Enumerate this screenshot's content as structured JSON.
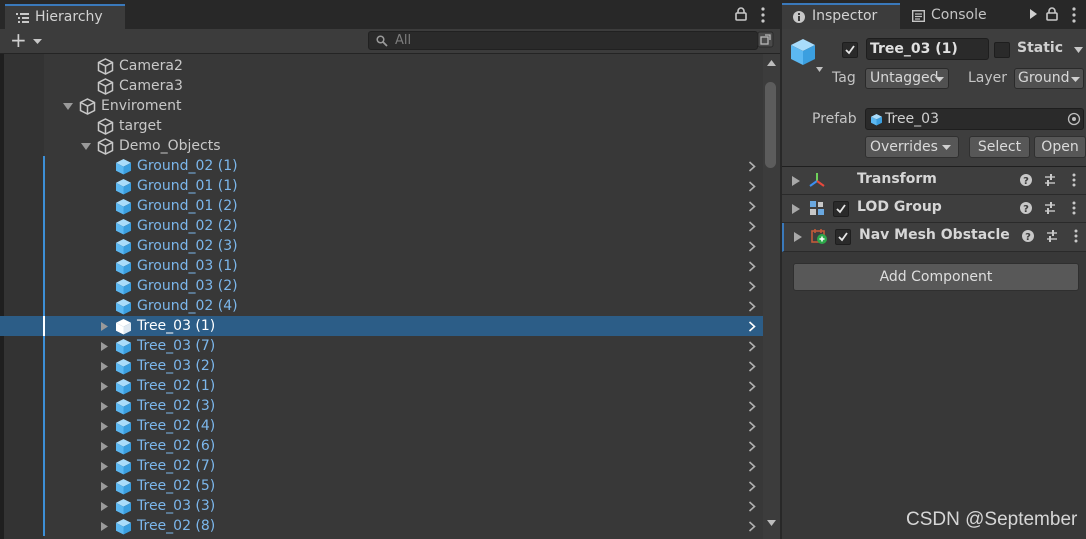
{
  "hierarchy": {
    "tab_label": "Hierarchy",
    "search_placeholder": "All",
    "add_button_label": "+",
    "rows": [
      {
        "name": "Camera2",
        "kind": "plain",
        "indent": 1,
        "expandable": false
      },
      {
        "name": "Camera3",
        "kind": "plain",
        "indent": 1,
        "expandable": false
      },
      {
        "name": "Enviroment",
        "kind": "plain",
        "indent": 0,
        "expandable": true,
        "expanded": true
      },
      {
        "name": "target",
        "kind": "plain",
        "indent": 1,
        "expandable": false
      },
      {
        "name": "Demo_Objects",
        "kind": "plain",
        "indent": 1,
        "expandable": true,
        "expanded": true
      },
      {
        "name": "Ground_02 (1)",
        "kind": "prefab",
        "indent": 2,
        "expandable": false
      },
      {
        "name": "Ground_01 (1)",
        "kind": "prefab",
        "indent": 2,
        "expandable": false
      },
      {
        "name": "Ground_01 (2)",
        "kind": "prefab",
        "indent": 2,
        "expandable": false
      },
      {
        "name": "Ground_02 (2)",
        "kind": "prefab",
        "indent": 2,
        "expandable": false
      },
      {
        "name": "Ground_02 (3)",
        "kind": "prefab",
        "indent": 2,
        "expandable": false
      },
      {
        "name": "Ground_03 (1)",
        "kind": "prefab",
        "indent": 2,
        "expandable": false
      },
      {
        "name": "Ground_03 (2)",
        "kind": "prefab",
        "indent": 2,
        "expandable": false
      },
      {
        "name": "Ground_02 (4)",
        "kind": "prefab",
        "indent": 2,
        "expandable": false
      },
      {
        "name": "Tree_03 (1)",
        "kind": "prefab",
        "indent": 2,
        "expandable": true,
        "expanded": false,
        "selected": true
      },
      {
        "name": "Tree_03 (7)",
        "kind": "prefab",
        "indent": 2,
        "expandable": true,
        "expanded": false
      },
      {
        "name": "Tree_03 (2)",
        "kind": "prefab",
        "indent": 2,
        "expandable": true,
        "expanded": false
      },
      {
        "name": "Tree_02 (1)",
        "kind": "prefab",
        "indent": 2,
        "expandable": true,
        "expanded": false
      },
      {
        "name": "Tree_02 (3)",
        "kind": "prefab",
        "indent": 2,
        "expandable": true,
        "expanded": false
      },
      {
        "name": "Tree_02 (4)",
        "kind": "prefab",
        "indent": 2,
        "expandable": true,
        "expanded": false
      },
      {
        "name": "Tree_02 (6)",
        "kind": "prefab",
        "indent": 2,
        "expandable": true,
        "expanded": false
      },
      {
        "name": "Tree_02 (7)",
        "kind": "prefab",
        "indent": 2,
        "expandable": true,
        "expanded": false
      },
      {
        "name": "Tree_02 (5)",
        "kind": "prefab",
        "indent": 2,
        "expandable": true,
        "expanded": false
      },
      {
        "name": "Tree_03 (3)",
        "kind": "prefab",
        "indent": 2,
        "expandable": true,
        "expanded": false
      },
      {
        "name": "Tree_02 (8)",
        "kind": "prefab",
        "indent": 2,
        "expandable": true,
        "expanded": false
      }
    ]
  },
  "inspector": {
    "tabs": [
      {
        "label": "Inspector",
        "icon": "info-icon",
        "active": true
      },
      {
        "label": "Console",
        "icon": "console-icon",
        "active": false
      }
    ],
    "object": {
      "name": "Tree_03 (1)",
      "active": true,
      "static_label": "Static",
      "static_checked": false,
      "tag_label": "Tag",
      "tag_value": "Untagged",
      "layer_label": "Layer",
      "layer_value": "Ground"
    },
    "prefab": {
      "label": "Prefab",
      "asset": "Tree_03",
      "overrides_label": "Overrides",
      "select_label": "Select",
      "open_label": "Open"
    },
    "components": [
      {
        "name": "Transform",
        "icon": "transform-icon",
        "has_toggle": false
      },
      {
        "name": "LOD Group",
        "icon": "lod-group-icon",
        "has_toggle": true,
        "enabled": true
      },
      {
        "name": "Nav Mesh Obstacle",
        "icon": "nav-mesh-obstacle-icon",
        "has_toggle": true,
        "enabled": true
      }
    ],
    "add_component_label": "Add Component"
  },
  "watermark": "CSDN @September",
  "colors": {
    "selection": "#2c5d87",
    "prefab_text": "#7cb7ec",
    "accent": "#3a79bb",
    "cube_prefab": "#5cb8f2"
  }
}
